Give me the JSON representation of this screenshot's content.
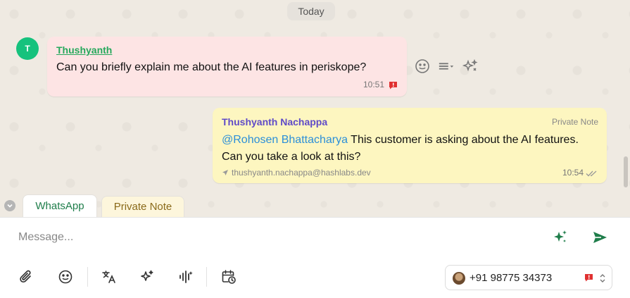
{
  "chat": {
    "date_label": "Today",
    "incoming": {
      "avatar_initial": "T",
      "sender": "Thushyanth",
      "text": "Can you briefly explain me about the AI features in periskope?",
      "time": "10:51"
    },
    "note": {
      "sender": "Thushyanth Nachappa",
      "label": "Private Note",
      "mention": "@Rohosen Bhattacharya",
      "text": " This customer is asking about the AI features. Can you take a look at this?",
      "author_email": "thushyanth.nachappa@hashlabs.dev",
      "time": "10:54"
    }
  },
  "tabs": [
    {
      "label": "WhatsApp",
      "active": true
    },
    {
      "label": "Private Note",
      "active": false
    }
  ],
  "composer": {
    "placeholder": "Message...",
    "phone_number": "+91 98775 34373"
  },
  "icons": {
    "message_actions": [
      "smile-icon",
      "list-menu-icon",
      "ai-sparkle-icon"
    ],
    "toolbar": [
      "paperclip-icon",
      "emoji-icon",
      "translate-icon",
      "ai-sparkle-icon",
      "voice-wave-icon",
      "schedule-icon"
    ]
  },
  "colors": {
    "accent_green": "#1e7d4a",
    "incoming_bubble": "#fde4e4",
    "note_bubble": "#fdf6c0",
    "mention_blue": "#2b8fd9",
    "note_sender": "#5f4bc8",
    "status_red": "#e03131"
  }
}
